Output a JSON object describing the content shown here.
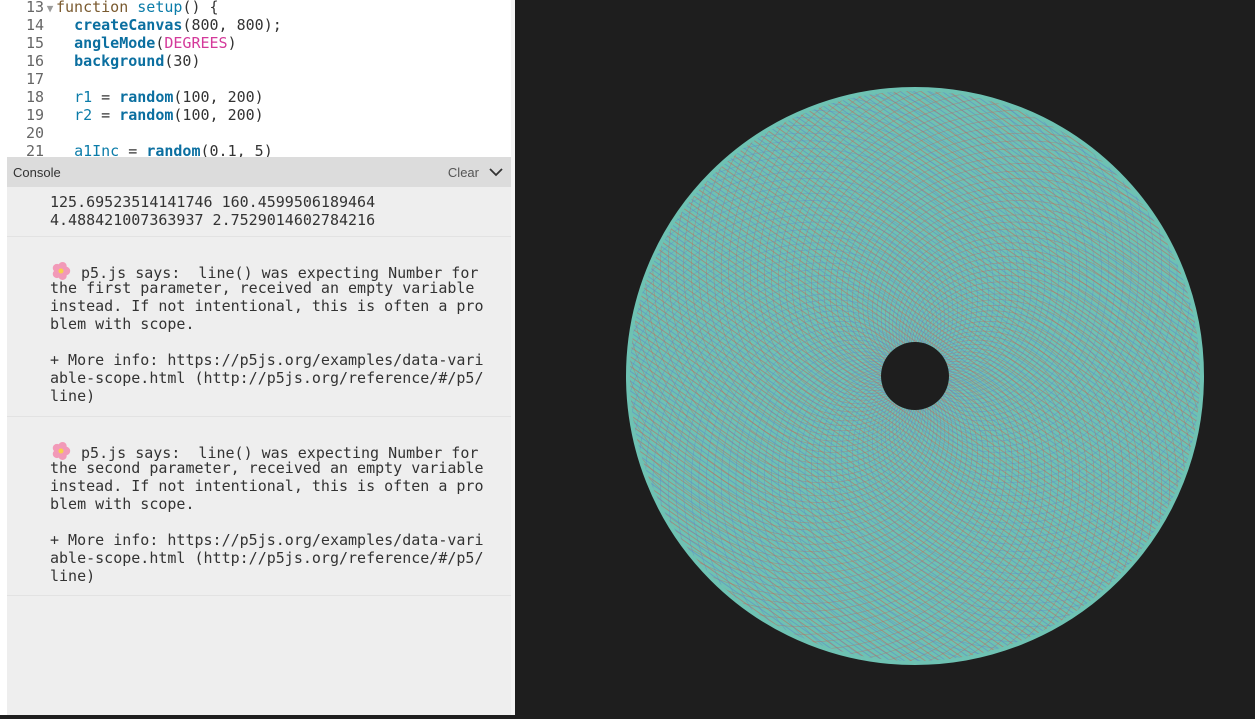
{
  "editor": {
    "lines": [
      {
        "num": "13",
        "fold": "▼",
        "parts": [
          [
            "kw-fn",
            "function "
          ],
          [
            "kw-name",
            "setup"
          ],
          [
            "punct",
            "() {"
          ]
        ]
      },
      {
        "num": "14",
        "fold": "",
        "parts": [
          [
            "punct",
            "  "
          ],
          [
            "kw-call",
            "createCanvas"
          ],
          [
            "punct",
            "(800, 800);"
          ]
        ]
      },
      {
        "num": "15",
        "fold": "",
        "parts": [
          [
            "punct",
            "  "
          ],
          [
            "kw-call",
            "angleMode"
          ],
          [
            "punct",
            "("
          ],
          [
            "kw-const",
            "DEGREES"
          ],
          [
            "punct",
            ")"
          ]
        ]
      },
      {
        "num": "16",
        "fold": "",
        "parts": [
          [
            "punct",
            "  "
          ],
          [
            "kw-call",
            "background"
          ],
          [
            "punct",
            "(30)"
          ]
        ]
      },
      {
        "num": "17",
        "fold": "",
        "parts": []
      },
      {
        "num": "18",
        "fold": "",
        "parts": [
          [
            "punct",
            "  "
          ],
          [
            "kw-name",
            "r1"
          ],
          [
            "punct",
            " = "
          ],
          [
            "kw-call",
            "random"
          ],
          [
            "punct",
            "(100, 200)"
          ]
        ]
      },
      {
        "num": "19",
        "fold": "",
        "parts": [
          [
            "punct",
            "  "
          ],
          [
            "kw-name",
            "r2"
          ],
          [
            "punct",
            " = "
          ],
          [
            "kw-call",
            "random"
          ],
          [
            "punct",
            "(100, 200)"
          ]
        ]
      },
      {
        "num": "20",
        "fold": "",
        "parts": []
      },
      {
        "num": "21",
        "fold": "",
        "parts": [
          [
            "punct",
            "  "
          ],
          [
            "kw-name",
            "a1Inc"
          ],
          [
            "punct",
            " = "
          ],
          [
            "kw-call",
            "random"
          ],
          [
            "punct",
            "(0.1, 5)"
          ]
        ]
      }
    ]
  },
  "console": {
    "title": "Console",
    "clear_label": "Clear",
    "messages": [
      {
        "lines": [
          "125.69523514141746 160.4599506189464",
          "4.488421007363937 2.7529014602784216"
        ],
        "icon": false
      },
      {
        "lines": [
          "p5.js says:  line() was expecting Number for",
          "the first parameter, received an empty variable",
          "instead. If not intentional, this is often a pro",
          "blem with scope.",
          "",
          "+ More info: https://p5js.org/examples/data-vari",
          "able-scope.html (http://p5js.org/reference/#/p5/",
          "line)"
        ],
        "icon": true
      },
      {
        "lines": [
          "p5.js says:  line() was expecting Number for",
          "the second parameter, received an empty variable",
          "instead. If not intentional, this is often a pro",
          "blem with scope.",
          "",
          "+ More info: https://p5js.org/examples/data-vari",
          "able-scope.html (http://p5js.org/reference/#/p5/",
          "line)"
        ],
        "icon": true
      }
    ]
  },
  "colors": {
    "canvas_bg": "#1e1e1e",
    "ring_teal": "#6ec2b3",
    "pattern_red": "#c0685a",
    "pattern_blue": "#5f86c9"
  },
  "icons": {
    "flower": "flower-icon",
    "chevron": "chevron-down-icon",
    "fold": "fold-arrow-icon"
  }
}
